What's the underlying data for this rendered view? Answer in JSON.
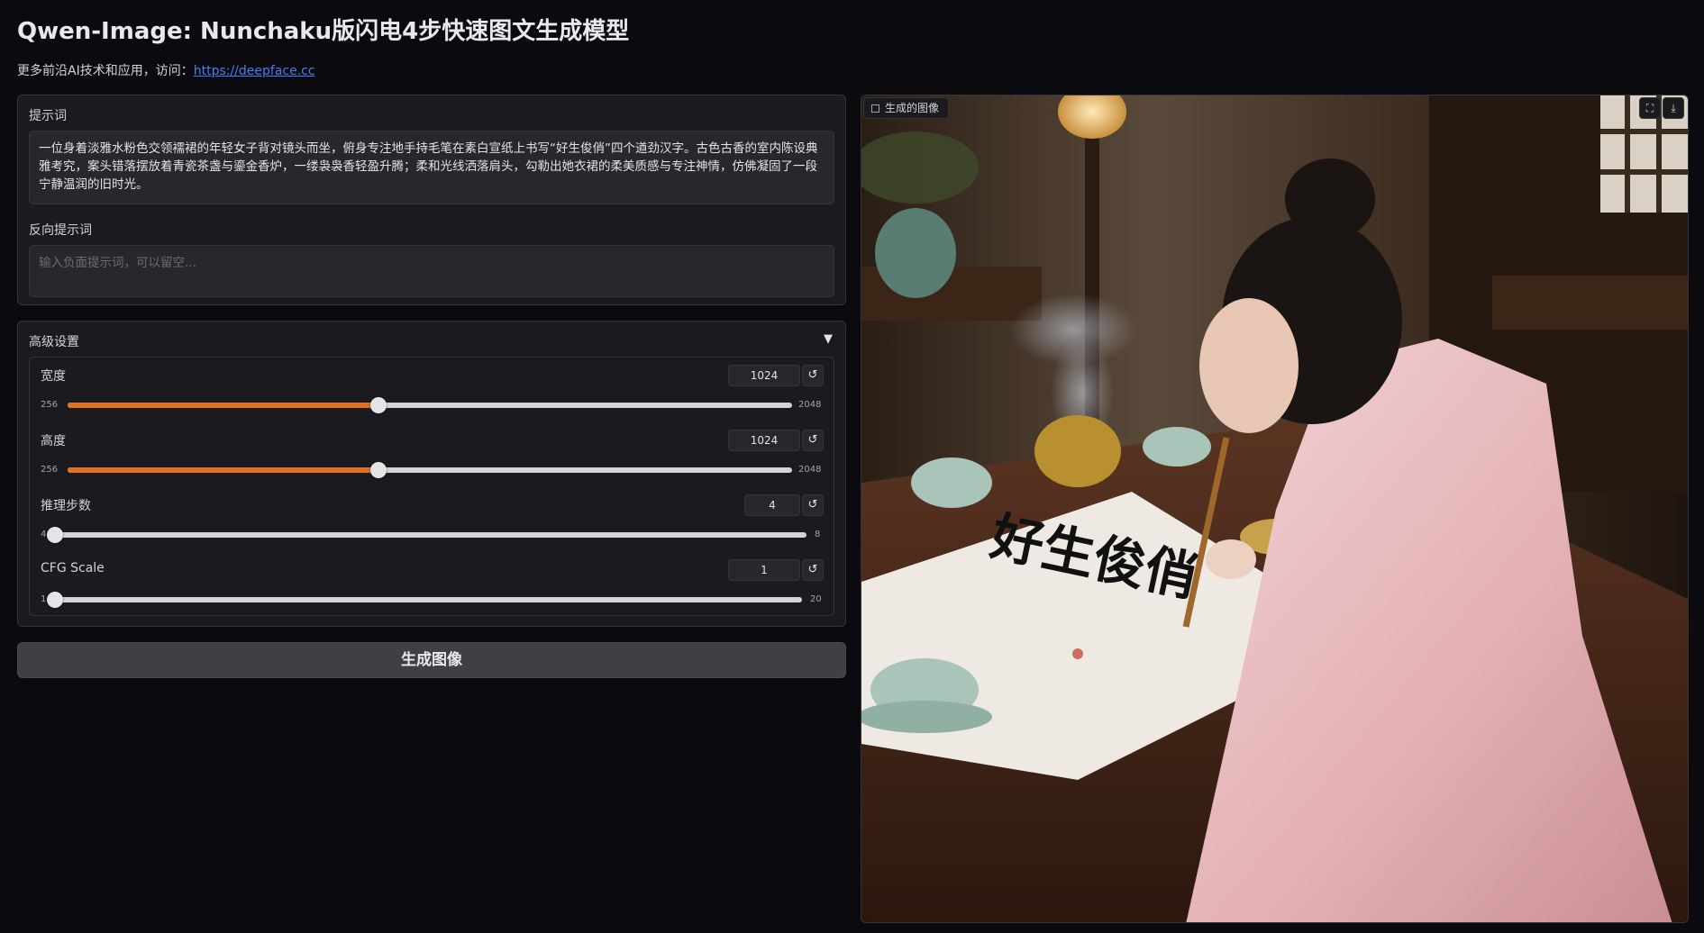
{
  "header": {
    "title": "Qwen-Image: Nunchaku版闪电4步快速图文生成模型",
    "subtitle_prefix": "更多前沿AI技术和应用，访问：",
    "link_text": "https://deepface.cc"
  },
  "prompt": {
    "label": "提示词",
    "value": "一位身着淡雅水粉色交领襦裙的年轻女子背对镜头而坐，俯身专注地手持毛笔在素白宣纸上书写“好生俊俏”四个遒劲汉字。古色古香的室内陈设典雅考究，案头错落摆放着青瓷茶盏与鎏金香炉，一缕袅袅香轻盈升腾；柔和光线洒落肩头，勾勒出她衣裙的柔美质感与专注神情，仿佛凝固了一段宁静温润的旧时光。"
  },
  "negative_prompt": {
    "label": "反向提示词",
    "placeholder": "输入负面提示词，可以留空..."
  },
  "advanced": {
    "label": "高级设置",
    "caret": "▼",
    "sliders": [
      {
        "label": "宽度",
        "value": "1024",
        "min": "256",
        "max": "2048",
        "fraction": 0.4286
      },
      {
        "label": "高度",
        "value": "1024",
        "min": "256",
        "max": "2048",
        "fraction": 0.4286
      },
      {
        "label": "推理步数",
        "value": "4",
        "min": "4",
        "max": "8",
        "fraction": 0
      },
      {
        "label": "CFG Scale",
        "value": "1",
        "min": "1",
        "max": "20",
        "fraction": 0
      }
    ],
    "reset_glyph": "↺"
  },
  "generate": {
    "label": "生成图像"
  },
  "output": {
    "label": "生成的图像",
    "fullscreen_glyph": "⛶",
    "download_glyph": "⤓",
    "calligraphy_text": "好生俊俏"
  },
  "colors": {
    "accent": "#e0711e",
    "background": "#0b0b0f",
    "panel": "#1b1b1f",
    "link": "#4b7bf5"
  }
}
